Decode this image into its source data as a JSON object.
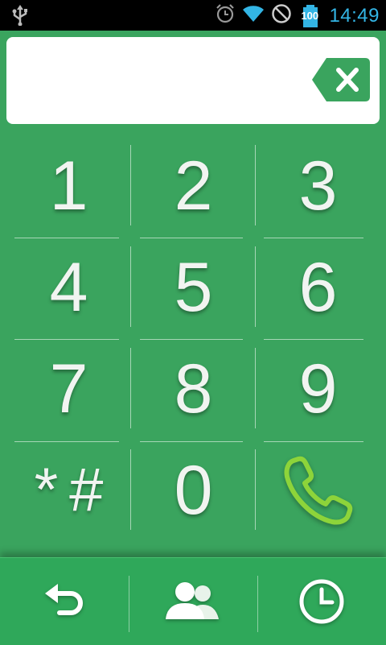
{
  "status_bar": {
    "time": "14:49",
    "battery_level": "100",
    "icons": [
      "usb-icon",
      "alarm-icon",
      "wifi-icon",
      "no-signal-icon",
      "battery-icon"
    ]
  },
  "display": {
    "number": "",
    "backspace_icon": "backspace-icon"
  },
  "keypad": {
    "keys": [
      "1",
      "2",
      "3",
      "4",
      "5",
      "6",
      "7",
      "8",
      "9",
      "*",
      "#",
      "0"
    ],
    "call_icon": "phone-call-icon"
  },
  "bottom_nav": {
    "items": [
      {
        "icon": "back-arrow-icon"
      },
      {
        "icon": "contacts-icon"
      },
      {
        "icon": "clock-history-icon"
      }
    ]
  },
  "colors": {
    "background": "#3aa45e",
    "status_bar": "#000000",
    "status_accent": "#33b5e5",
    "call_icon": "#8dd43a",
    "backspace_fill": "#3aa45e"
  }
}
